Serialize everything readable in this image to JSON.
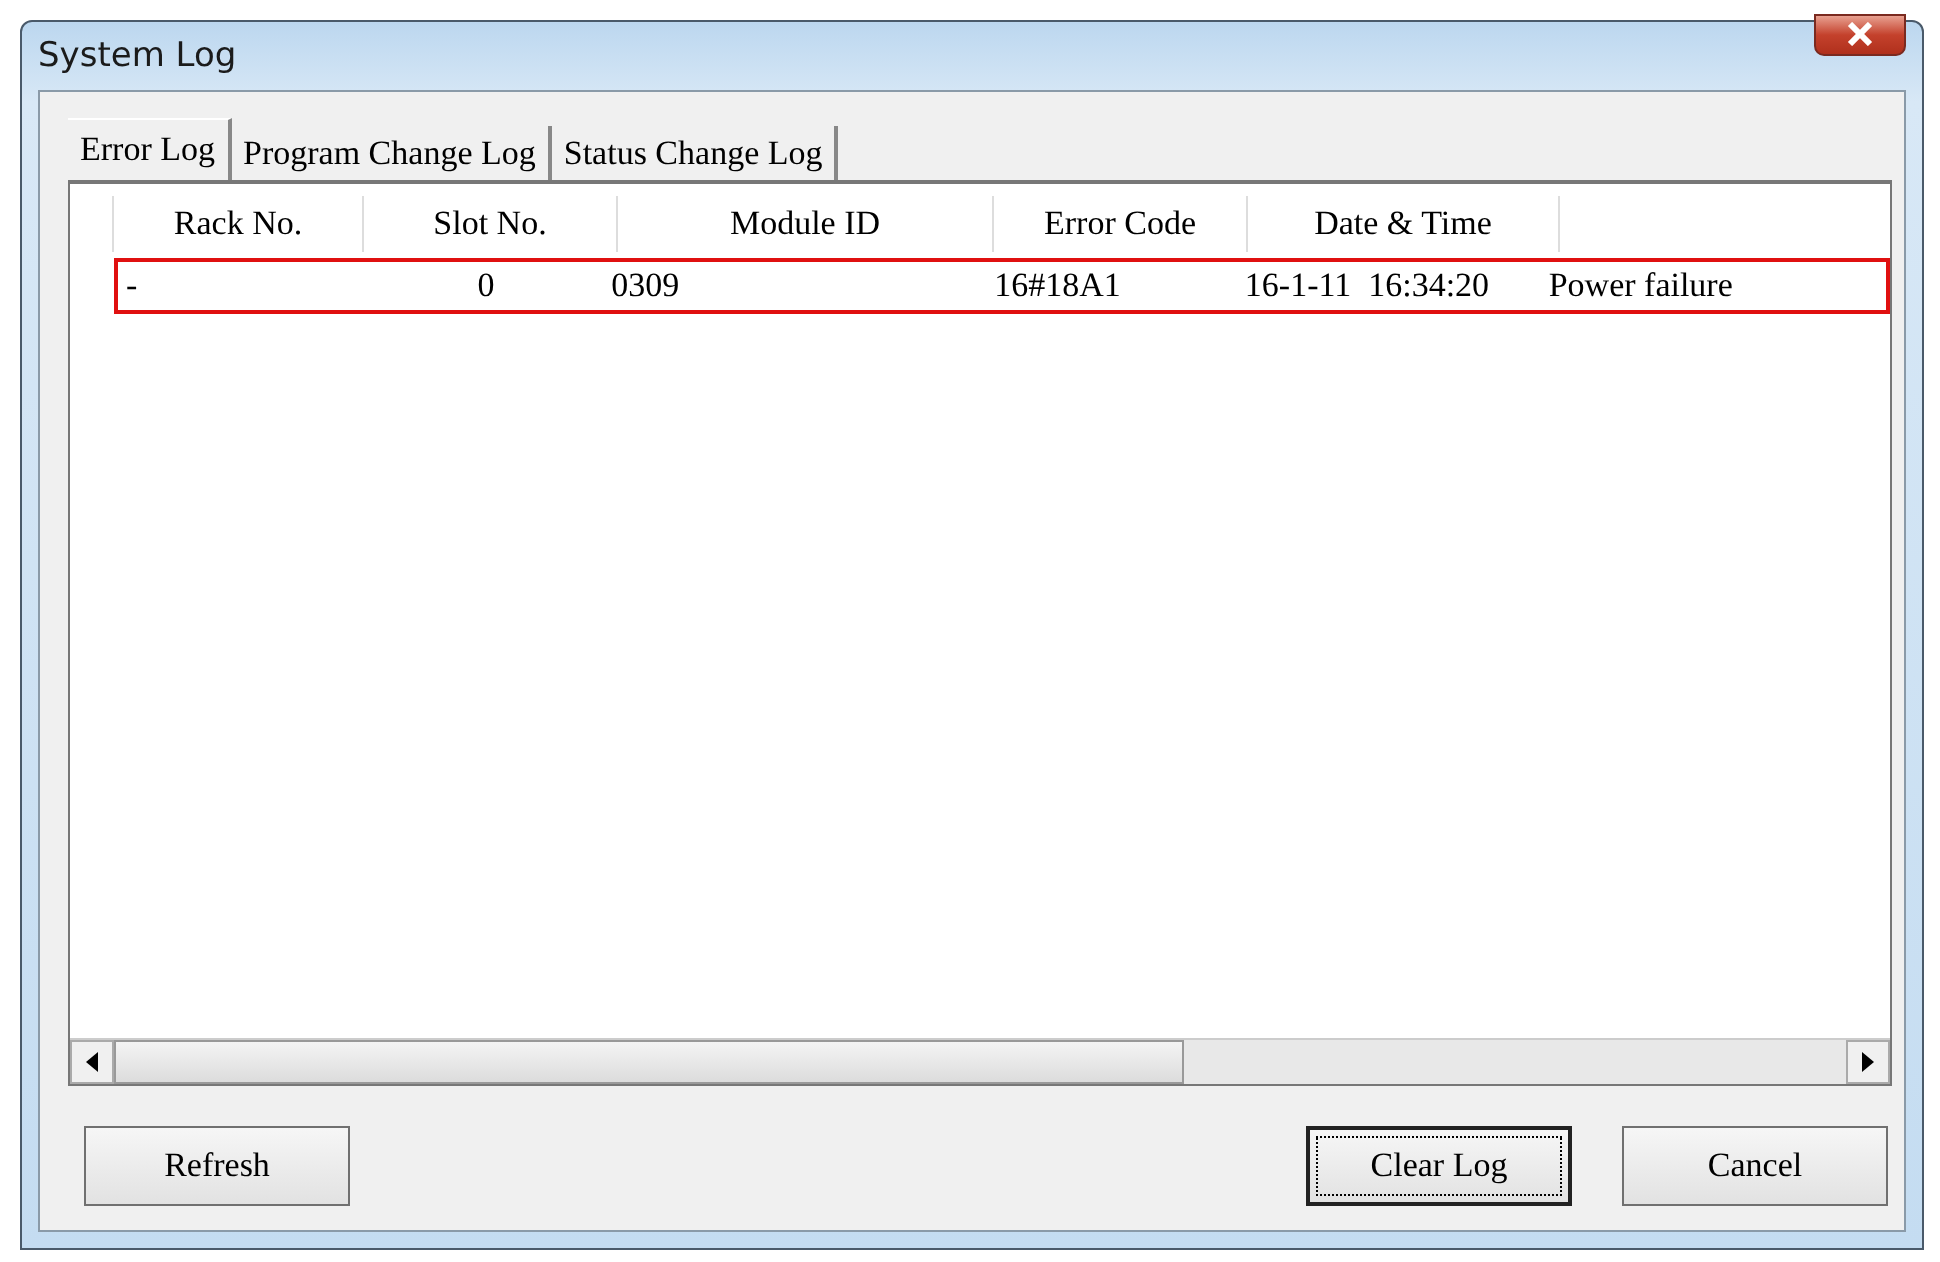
{
  "window": {
    "title": "System Log"
  },
  "tabs": [
    {
      "label": "Error Log",
      "selected": true
    },
    {
      "label": "Program Change Log",
      "selected": false
    },
    {
      "label": "Status Change Log",
      "selected": false
    }
  ],
  "table": {
    "columns": [
      "Rack No.",
      "Slot No.",
      "Module ID",
      "Error Code",
      "Date & Time"
    ],
    "rows": [
      {
        "selected": true,
        "cells": [
          "-",
          "0",
          "0309",
          "16#18A1",
          "16-1-11  16:34:20",
          "Power failure"
        ]
      }
    ]
  },
  "buttons": [
    {
      "label": "Refresh",
      "focused": false
    },
    {
      "label": "Clear Log",
      "focused": true
    },
    {
      "label": "Cancel",
      "focused": false
    }
  ]
}
